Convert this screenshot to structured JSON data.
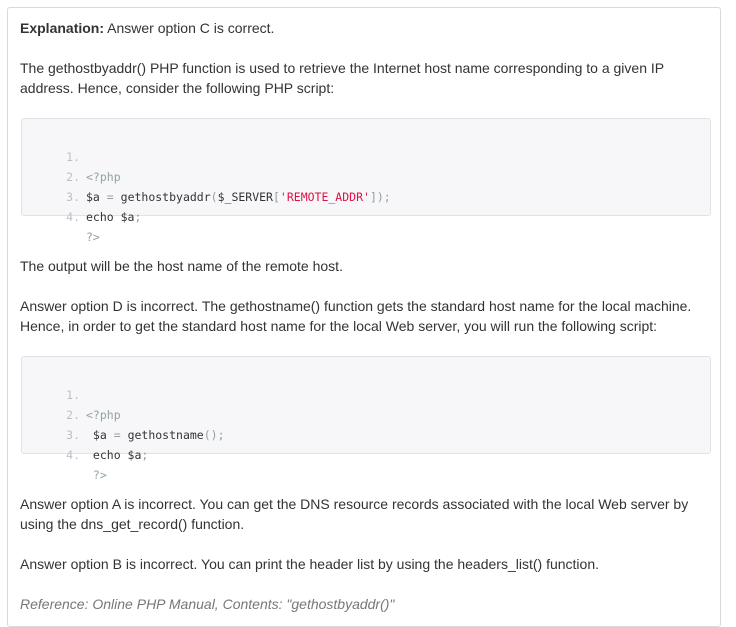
{
  "explanation": {
    "label": "Explanation:",
    "text": " Answer option C is correct."
  },
  "intro": "The gethostbyaddr() PHP function is used to retrieve the Internet host name corresponding to a given IP address. Hence, consider the following PHP script:",
  "code1": {
    "lines": [
      {
        "num": "1.",
        "parts": [
          "<?php"
        ]
      },
      {
        "num": "2.",
        "parts": [
          "$a ",
          "=",
          " gethostbyaddr",
          "(",
          "$_SERVER",
          "[",
          "'REMOTE_ADDR'",
          "]);"
        ]
      },
      {
        "num": "3.",
        "parts": [
          "echo $a",
          ";"
        ]
      },
      {
        "num": "4.",
        "parts": [
          "?>"
        ]
      }
    ]
  },
  "output_text": "The output will be the host name of the remote host.",
  "option_d": "Answer option D is incorrect. The gethostname() function gets the standard host name for the local machine. Hence, in order to get the standard host name for the local Web server, you will run the following script:",
  "code2": {
    "lines": [
      {
        "num": "1.",
        "parts": [
          "<?php"
        ]
      },
      {
        "num": "2.",
        "parts": [
          " $a ",
          "=",
          " gethostname",
          "();"
        ]
      },
      {
        "num": "3.",
        "parts": [
          " echo $a",
          ";"
        ]
      },
      {
        "num": "4.",
        "parts": [
          " ?>"
        ]
      }
    ]
  },
  "option_a": "Answer option A is incorrect. You can get the DNS resource records associated with the local Web server by using the dns_get_record() function.",
  "option_b": "Answer option B is incorrect. You can print the header list by using the headers_list() function.",
  "reference": "Reference: Online PHP Manual, Contents: \"gethostbyaddr()\""
}
